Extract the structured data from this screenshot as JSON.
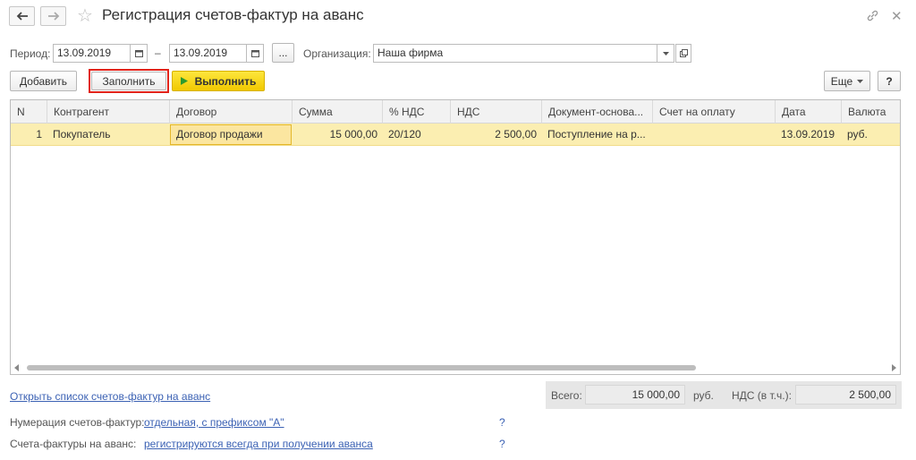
{
  "window": {
    "title": "Регистрация счетов-фактур на аванс"
  },
  "period": {
    "label": "Период:",
    "from": "13.09.2019",
    "dash": "–",
    "to": "13.09.2019",
    "more_label": "..."
  },
  "organization": {
    "label": "Организация:",
    "value": "Наша фирма"
  },
  "toolbar": {
    "add_label": "Добавить",
    "fill_label": "Заполнить",
    "run_label": "Выполнить",
    "more_label": "Еще",
    "help_label": "?"
  },
  "table": {
    "columns": [
      "N",
      "Контрагент",
      "Договор",
      "Сумма",
      "% НДС",
      "НДС",
      "Документ-основа...",
      "Счет на оплату",
      "Дата",
      "Валюта"
    ],
    "rows": [
      {
        "n": "1",
        "counterparty": "Покупатель",
        "contract": "Договор продажи",
        "sum": "15 000,00",
        "vat_rate": "20/120",
        "vat": "2 500,00",
        "base_doc": "Поступление на р...",
        "invoice": "",
        "date": "13.09.2019",
        "currency": "руб."
      }
    ]
  },
  "footer": {
    "open_list_link": "Открыть список счетов-фактур на аванс",
    "numbering_label": "Нумерация счетов-фактур:",
    "numbering_link": "отдельная, с префиксом \"А\"",
    "invoices_label": "Счета-фактуры на аванс:",
    "invoices_link": "регистрируются всегда при получении аванса",
    "help_mark": "?",
    "total_label": "Всего:",
    "total_value": "15 000,00",
    "total_currency": "руб.",
    "vat_label": "НДС (в т.ч.):",
    "vat_value": "2 500,00"
  },
  "colors": {
    "accent_yellow": "#f1c900",
    "row_highlight": "#fbeeb1",
    "link_blue": "#3c62b4",
    "highlight_frame": "#e2231a"
  },
  "icons": [
    "back-arrow-icon",
    "forward-arrow-icon",
    "favorite-star-icon",
    "link-icon",
    "close-icon",
    "calendar-icon",
    "dropdown-arrow-icon",
    "open-icon",
    "play-icon",
    "chevron-down-icon",
    "scroll-left-icon",
    "scroll-right-icon"
  ]
}
